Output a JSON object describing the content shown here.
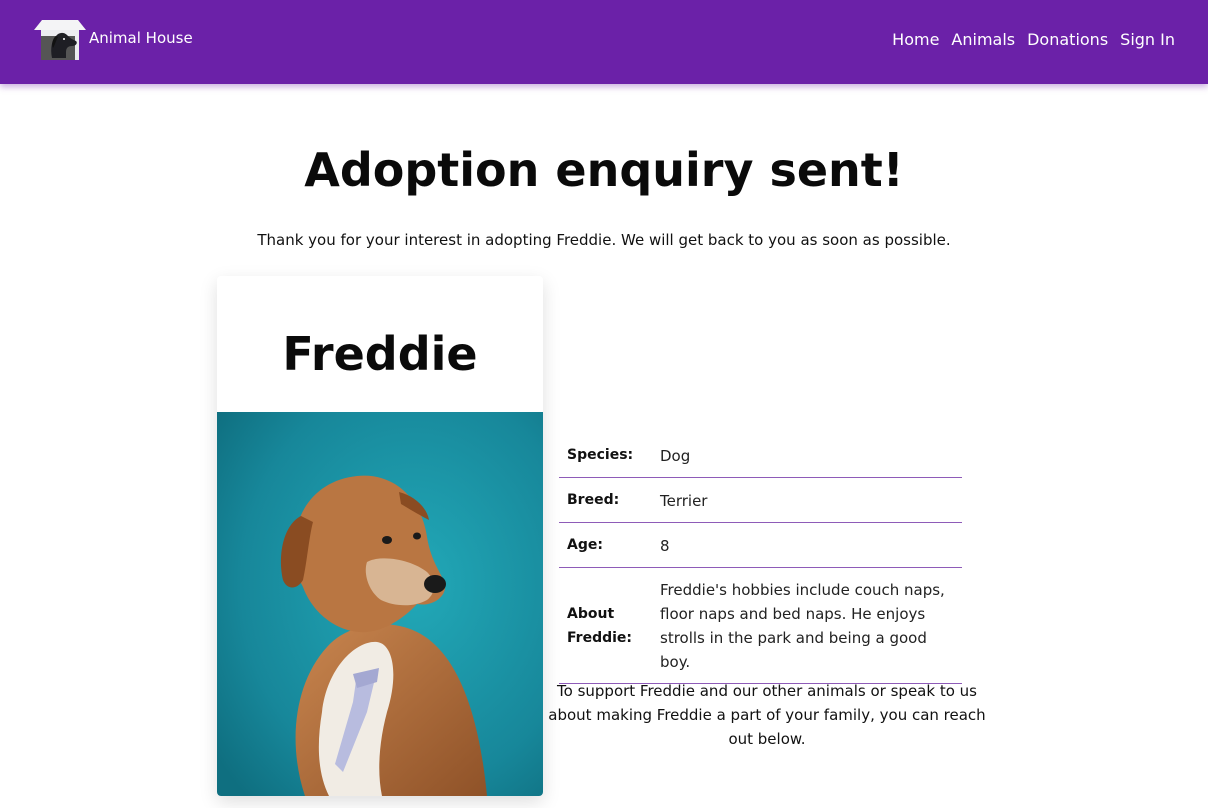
{
  "nav": {
    "brand": "Animal House",
    "links": [
      "Home",
      "Animals",
      "Donations",
      "Sign In"
    ]
  },
  "main": {
    "title": "Adoption enquiry sent!",
    "lead": "Thank you for your interest in adopting Freddie. We will get back to you as soon as possible.",
    "card": {
      "name": "Freddie",
      "photo_icon": "dog-photo"
    },
    "details": [
      {
        "label": "Species:",
        "value": "Dog"
      },
      {
        "label": "Breed:",
        "value": "Terrier"
      },
      {
        "label": "Age:",
        "value": "8"
      },
      {
        "label": "About Freddie:",
        "value": "Freddie's hobbies include couch naps, floor naps and bed naps. He enjoys strolls in the park and being a good boy."
      }
    ],
    "support": "To support Freddie and our other animals or speak to us about making Freddie a part of your family, you can reach out below."
  },
  "colors": {
    "brand": "#6b21a8",
    "divider": "#8e5bb8",
    "photo_bg": "#1a8e9e"
  }
}
